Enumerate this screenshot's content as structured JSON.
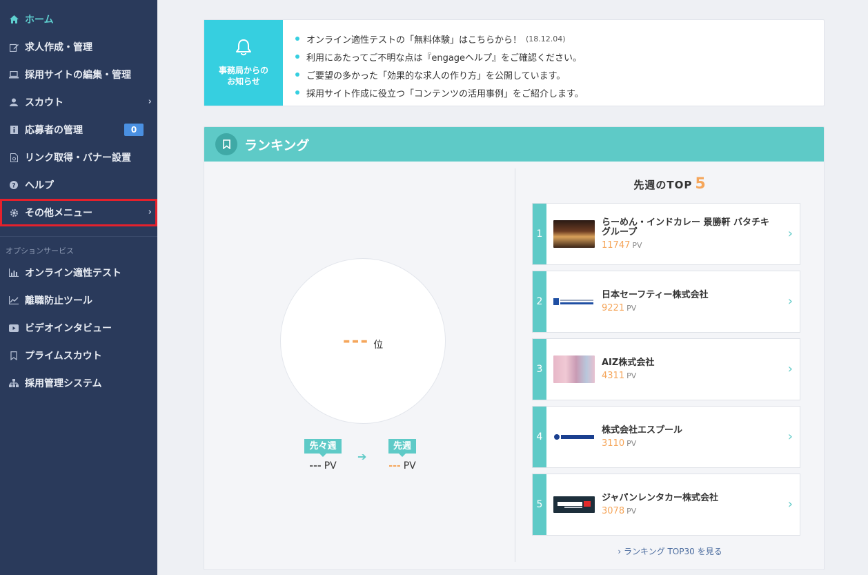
{
  "sidebar": {
    "items": [
      {
        "label": "ホーム",
        "icon": "home-icon"
      },
      {
        "label": "求人作成・管理",
        "icon": "edit-icon"
      },
      {
        "label": "採用サイトの編集・管理",
        "icon": "laptop-icon"
      },
      {
        "label": "スカウト",
        "icon": "user-icon"
      },
      {
        "label": "応募者の管理",
        "icon": "info-icon",
        "badge": "0"
      },
      {
        "label": "リンク取得・バナー設置",
        "icon": "link-file-icon"
      },
      {
        "label": "ヘルプ",
        "icon": "help-icon"
      },
      {
        "label": "その他メニュー",
        "icon": "gear-icon"
      }
    ],
    "section_label": "オプションサービス",
    "option_items": [
      {
        "label": "オンライン適性テスト",
        "icon": "bar-chart-icon"
      },
      {
        "label": "離職防止ツール",
        "icon": "line-chart-icon"
      },
      {
        "label": "ビデオインタビュー",
        "icon": "video-icon"
      },
      {
        "label": "プライムスカウト",
        "icon": "bookmark-icon"
      },
      {
        "label": "採用管理システム",
        "icon": "org-chart-icon"
      }
    ]
  },
  "notice": {
    "title_line1": "事務局からの",
    "title_line2": "お知らせ",
    "items": [
      {
        "text": "オンライン適性テストの「無料体験」はこちらから！",
        "date": "(18.12.04)"
      },
      {
        "text": "利用にあたってご不明な点は『engageヘルプ』をご確認ください。",
        "date": ""
      },
      {
        "text": "ご要望の多かった「効果的な求人の作り方」を公開しています。",
        "date": ""
      },
      {
        "text": "採用サイト作成に役立つ「コンテンツの活用事例」をご紹介します。",
        "date": ""
      }
    ]
  },
  "ranking": {
    "title": "ランキング",
    "rank_value": "---",
    "rank_unit": "位",
    "prev_prev_week_label": "先々週",
    "prev_week_label": "先週",
    "prev_prev_pv": "---",
    "prev_pv": "---",
    "pv_unit": "PV",
    "top_title": "先週のTOP",
    "top_number": "5",
    "top_items": [
      {
        "rank": "1",
        "name": "らーめん・インドカレー 景勝軒 バタチキグループ",
        "pv": "11747",
        "pv_label": "PV"
      },
      {
        "rank": "2",
        "name": "日本セーフティー株式会社",
        "pv": "9221",
        "pv_label": "PV"
      },
      {
        "rank": "3",
        "name": "AIZ株式会社",
        "pv": "4311",
        "pv_label": "PV"
      },
      {
        "rank": "4",
        "name": "株式会社エスプール",
        "pv": "3110",
        "pv_label": "PV"
      },
      {
        "rank": "5",
        "name": "ジャパンレンタカー株式会社",
        "pv": "3078",
        "pv_label": "PV"
      }
    ],
    "more_link": "› ランキング TOP30 を見る"
  },
  "colors": {
    "sidebar_bg": "#2a3a5b",
    "accent_teal": "#5ecac7",
    "notice_cyan": "#36cfe0",
    "orange": "#f5a65b",
    "badge_blue": "#4a90e2",
    "highlight_red": "#e5212c"
  }
}
